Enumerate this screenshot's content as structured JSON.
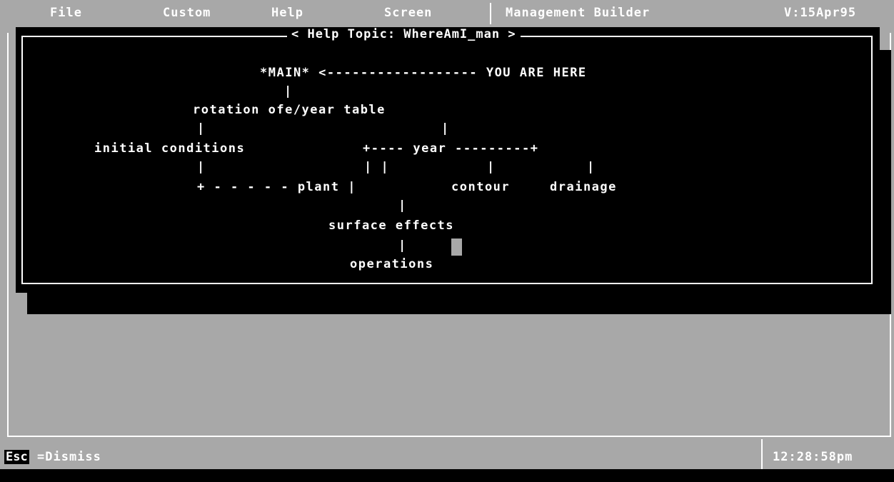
{
  "menubar": {
    "file": "File",
    "custom": "Custom",
    "help": "Help",
    "screen": "Screen",
    "module": "Management Builder",
    "version": "V:15Apr95"
  },
  "help_window": {
    "title": "< Help Topic: WhereAmI_man >",
    "lines": {
      "main": "*MAIN* <------------------ YOU ARE HERE",
      "bar1": "|",
      "rotation": "rotation ofe/year table",
      "bar_rot_left": "|",
      "bar_rot_right": "|",
      "initial": "initial conditions",
      "year": "+---- year ---------+",
      "bar_init": "|",
      "bar_year_a": "| |",
      "bar_year_b": "|",
      "bar_year_c": "|",
      "plant_branch": "+ - - - - - plant |",
      "contour": "contour",
      "drainage": "drainage",
      "bar_surface": "|",
      "surface": "surface effects",
      "bar_ops": "|",
      "operations": "operations"
    }
  },
  "statusbar": {
    "esc_key": "Esc",
    "dismiss": "=Dismiss",
    "clock": "12:28:58pm"
  }
}
